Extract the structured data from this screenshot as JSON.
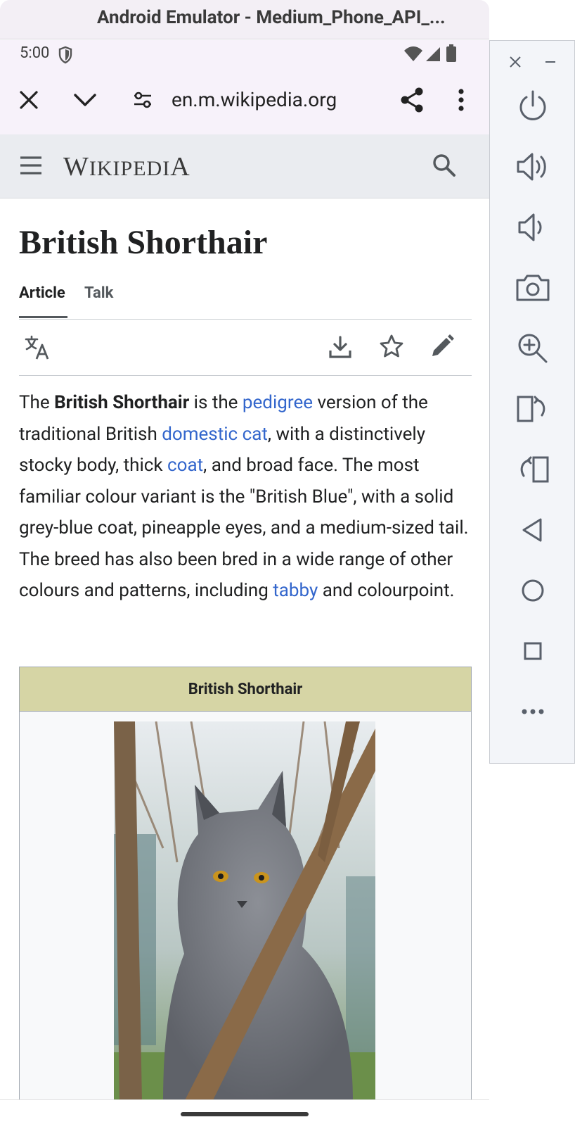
{
  "window": {
    "title": "Android Emulator - Medium_Phone_API_..."
  },
  "status_bar": {
    "time": "5:00"
  },
  "toolbar": {
    "url": "en.m.wikipedia.org"
  },
  "wiki": {
    "logo_big_w": "W",
    "logo_rest1": "IKIPEDI",
    "logo_big_a": "A"
  },
  "article": {
    "title": "British Shorthair",
    "tabs": [
      {
        "label": "Article"
      },
      {
        "label": "Talk"
      }
    ],
    "intro": {
      "p1": "The ",
      "b1": "British Shorthair",
      "p2": " is the ",
      "l1": "pedigree",
      "p3": " version of the traditional British ",
      "l2": "domestic cat",
      "p4": ", with a distinctively stocky body, thick ",
      "l3": "coat",
      "p5": ", and broad face. The most familiar colour variant is the \"British Blue\", with a solid grey-blue coat, pineapple eyes, and a medium-sized tail. The breed has also been bred in a wide range of other colours and patterns, including ",
      "l4": "tabby",
      "p6": " and colourpoint."
    },
    "infobox": {
      "title": "British Shorthair"
    }
  },
  "colors": {
    "link": "#3366cc",
    "infobox_header": "#d6d5a5",
    "text": "#202122"
  }
}
